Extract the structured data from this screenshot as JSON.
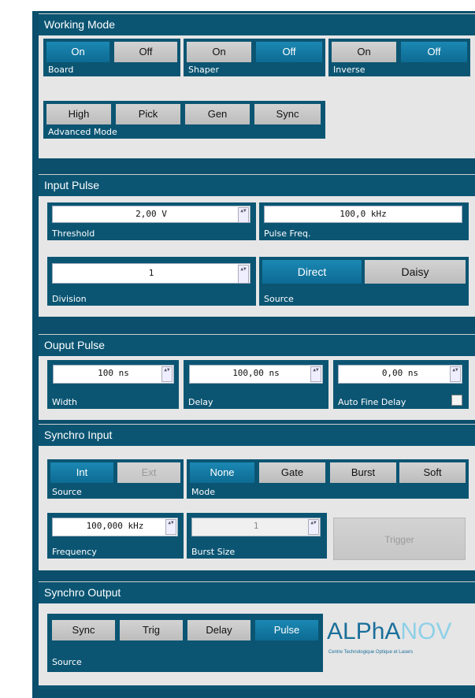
{
  "working_mode": {
    "title": "Working Mode",
    "board": {
      "label": "Board",
      "on": "On",
      "off": "Off",
      "selected": "On"
    },
    "shaper": {
      "label": "Shaper",
      "on": "On",
      "off": "Off",
      "selected": "Off"
    },
    "inverse": {
      "label": "Inverse",
      "on": "On",
      "off": "Off",
      "selected": "Off"
    },
    "advanced": {
      "label": "Advanced Mode",
      "options": [
        "High",
        "Pick",
        "Gen",
        "Sync"
      ]
    }
  },
  "input_pulse": {
    "title": "Input Pulse",
    "threshold": {
      "label": "Threshold",
      "value": "2,00 V"
    },
    "pulse_freq": {
      "label": "Pulse Freq.",
      "value": "100,0 kHz"
    },
    "division": {
      "label": "Division",
      "value": "1"
    },
    "source": {
      "label": "Source",
      "options": [
        "Direct",
        "Daisy"
      ],
      "selected": "Direct"
    }
  },
  "output_pulse": {
    "title": "Ouput Pulse",
    "width": {
      "label": "Width",
      "value": "100 ns"
    },
    "delay": {
      "label": "Delay",
      "value": "100,00 ns"
    },
    "fine_delay": {
      "label": "Auto Fine Delay",
      "value": "0,00 ns"
    }
  },
  "synchro_input": {
    "title": "Synchro Input",
    "source": {
      "label": "Source",
      "options": [
        "Int",
        "Ext"
      ],
      "selected": "Int"
    },
    "mode": {
      "label": "Mode",
      "options": [
        "None",
        "Gate",
        "Burst",
        "Soft"
      ],
      "selected": "None"
    },
    "frequency": {
      "label": "Frequency",
      "value": "100,000 kHz"
    },
    "burst_size": {
      "label": "Burst Size",
      "value": "1"
    },
    "trigger": "Trigger"
  },
  "synchro_output": {
    "title": "Synchro Output",
    "source": {
      "label": "Source",
      "options": [
        "Sync",
        "Trig",
        "Delay",
        "Pulse"
      ],
      "selected": "Pulse"
    }
  },
  "logo": {
    "brand_a": "ALPhA",
    "brand_b": "NOV",
    "tagline": "Centre Technologique Optique et Lasers"
  },
  "spin_glyph": "▲▼",
  "colors": {
    "frame": "#0b4f6c",
    "header": "#0b5573",
    "active": "#0d6b93",
    "panel": "#e6e6e6"
  }
}
